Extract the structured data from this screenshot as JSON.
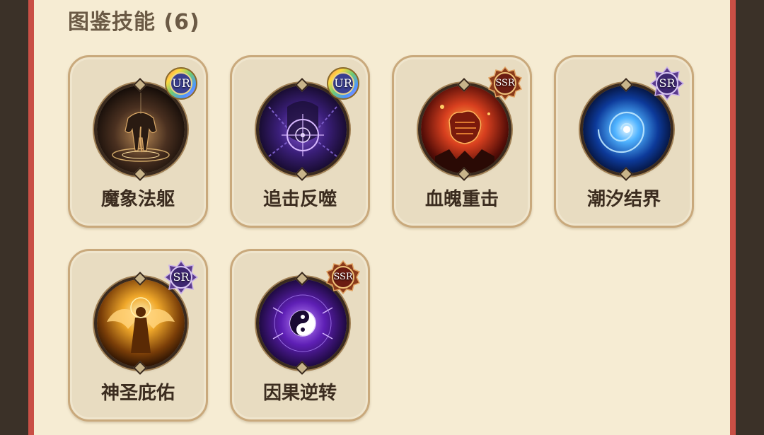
{
  "section": {
    "title": "图鉴技能 (6)"
  },
  "skills": [
    {
      "name": "魔象法躯",
      "rarity": "UR",
      "icon": "elephant-icon"
    },
    {
      "name": "追击反噬",
      "rarity": "UR",
      "icon": "crosshair-icon"
    },
    {
      "name": "血魄重击",
      "rarity": "SSR",
      "icon": "fist-icon"
    },
    {
      "name": "潮汐结界",
      "rarity": "SR",
      "icon": "vortex-icon"
    },
    {
      "name": "神圣庇佑",
      "rarity": "SR",
      "icon": "angel-icon"
    },
    {
      "name": "因果逆转",
      "rarity": "SSR",
      "icon": "yin-yang-icon"
    }
  ],
  "colors": {
    "panel": "#f6ecd3",
    "card": "#e8dcc1",
    "card_border": "#c9a97c",
    "frame": "#c94f45",
    "title": "#6b5a45",
    "name": "#3b2c1f"
  }
}
